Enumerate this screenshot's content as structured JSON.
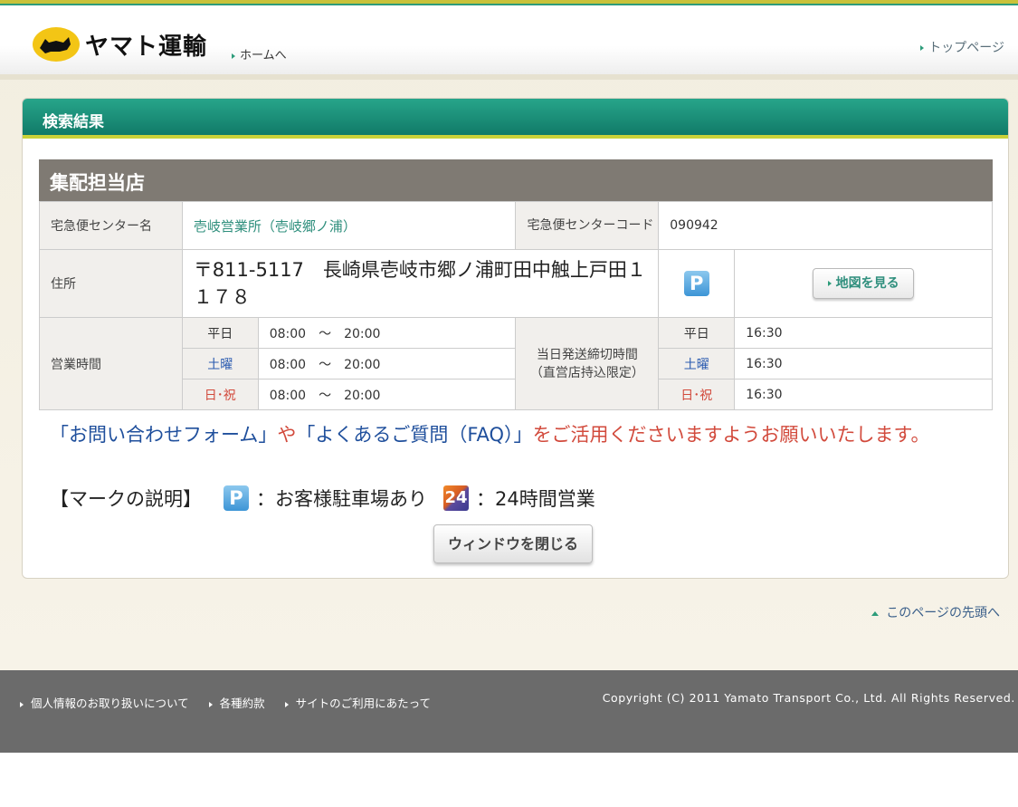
{
  "header": {
    "logo_text": "ヤマト運輸",
    "home_link": "ホームへ",
    "top_page_link": "トップページ"
  },
  "panel": {
    "title": "検索結果",
    "section_title": "集配担当店",
    "center_name_label": "宅急便センター名",
    "center_name_value": "壱岐営業所（壱岐郷ノ浦）",
    "center_code_label": "宅急便センターコード",
    "center_code_value": "090942",
    "address_label": "住所",
    "address_value": "〒811-5117　長崎県壱岐市郷ノ浦町田中触上戸田１１７８",
    "map_button": "地図を見る",
    "hours_label": "営業時間",
    "hours": [
      {
        "day": "平日",
        "time": "08:00　〜　20:00",
        "type": "weekday"
      },
      {
        "day": "土曜",
        "time": "08:00　〜　20:00",
        "type": "sat"
      },
      {
        "day": "日･祝",
        "time": "08:00　〜　20:00",
        "type": "sun"
      }
    ],
    "cutoff_label_1": "当日発送締切時間",
    "cutoff_label_2": "（直営店持込限定）",
    "cutoff": [
      {
        "day": "平日",
        "time": "16:30"
      },
      {
        "day": "土曜",
        "time": "16:30"
      },
      {
        "day": "日･祝",
        "time": "16:30"
      }
    ]
  },
  "notice": {
    "part1": "「お問い合わせフォーム」",
    "part2": "や",
    "part3": "「よくあるご質問（FAQ）」",
    "part4": "をご活用くださいますようお願いいたします。"
  },
  "legend": {
    "title": "【マークの説明】",
    "parking_icon": "P",
    "parking_text": "：お客様駐車場あり",
    "h24_icon": "24",
    "h24_text": "：24時間営業"
  },
  "close_button": "ウィンドウを閉じる",
  "page_top_link": "このページの先頭へ",
  "footer": {
    "links": [
      "個人情報のお取り扱いについて",
      "各種約款",
      "サイトのご利用にあたって"
    ],
    "copyright": "Copyright (C) 2011 Yamato Transport Co., Ltd. All Rights Reserved."
  },
  "colors": {
    "header_green": "#117a68",
    "accent_yellow": "#c9d139",
    "section_gray": "#7f7a73",
    "footer_gray": "#6b6b6b",
    "link_green": "#2f8f7d",
    "red_text": "#d24a3c",
    "blue_text": "#1f4f9c"
  }
}
